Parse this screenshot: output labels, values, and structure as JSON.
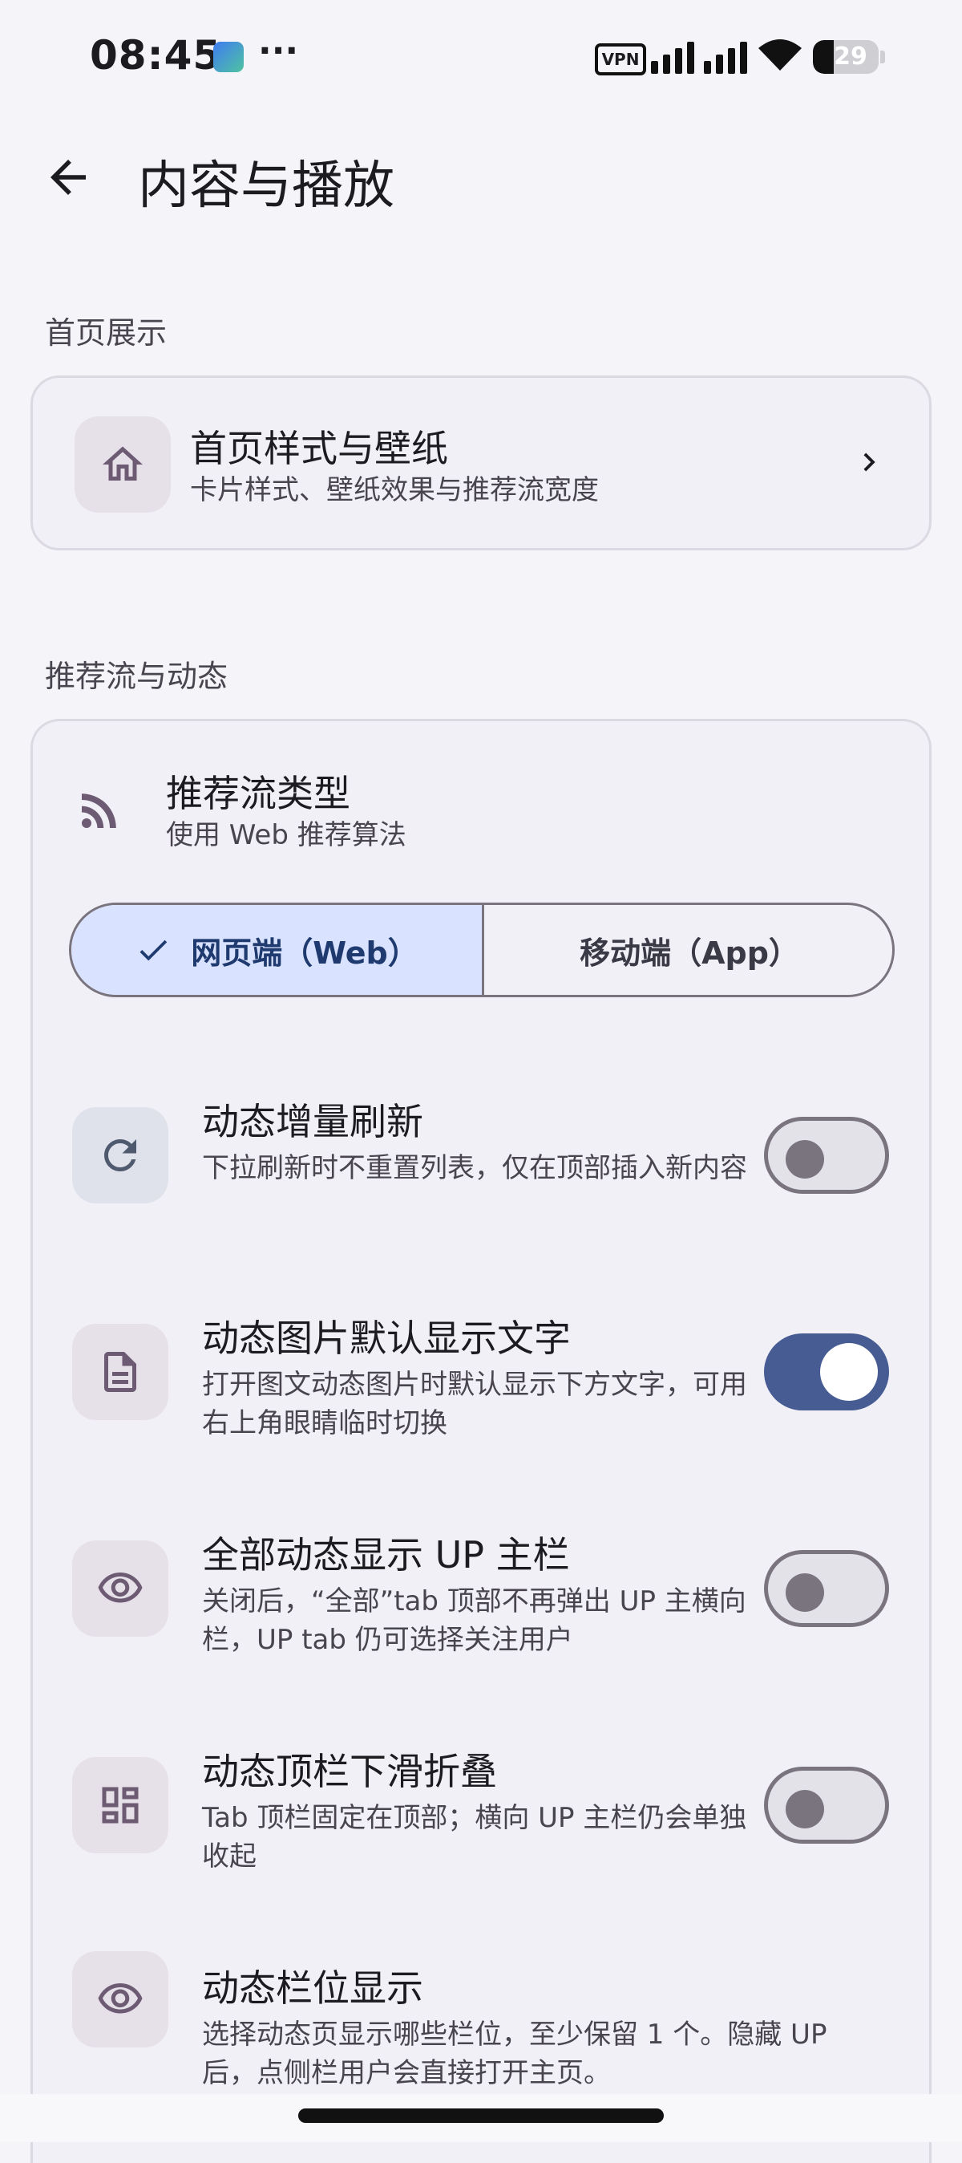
{
  "status_bar": {
    "time": "08:45",
    "dots": "···",
    "vpn": "VPN",
    "battery": "29"
  },
  "app_bar": {
    "title": "内容与播放"
  },
  "sections": {
    "home": {
      "label": "首页展示",
      "item": {
        "title": "首页样式与壁纸",
        "desc": "卡片样式、壁纸效果与推荐流宽度",
        "icon": "home-icon"
      }
    },
    "feed": {
      "label": "推荐流与动态",
      "feed_type": {
        "title": "推荐流类型",
        "desc": "使用 Web 推荐算法",
        "icon": "rss-icon"
      },
      "segmented": {
        "options": [
          "网页端（Web）",
          "移动端（App）"
        ],
        "selected": 0
      },
      "items": [
        {
          "title": "动态增量刷新",
          "desc": "下拉刷新时不重置列表，仅在顶部插入新内容",
          "icon": "refresh-icon",
          "on": false
        },
        {
          "title": "动态图片默认显示文字",
          "desc": "打开图文动态图片时默认显示下方文字，可用右上角眼睛临时切换",
          "icon": "article-icon",
          "on": true
        },
        {
          "title": "全部动态显示 UP 主栏",
          "desc": "关闭后，“全部”tab 顶部不再弹出 UP 主横向栏，UP tab 仍可选择关注用户",
          "icon": "eye-icon",
          "on": false
        },
        {
          "title": "动态顶栏下滑折叠",
          "desc": "Tab 顶栏固定在顶部；横向 UP 主栏仍会单独收起",
          "icon": "dashboard-icon",
          "on": false
        },
        {
          "title": "动态栏位显示",
          "desc": "选择动态页显示哪些栏位，至少保留 1 个。隐藏 UP 后，点侧栏用户会直接打开主页。",
          "icon": "eye-icon"
        }
      ]
    }
  },
  "colors": {
    "background": "#f5f4f9",
    "card": "#f2f0f7",
    "accent": "#465c92",
    "segment_selected": "#d9e2ff",
    "icon_tint": "#6d5a73"
  }
}
